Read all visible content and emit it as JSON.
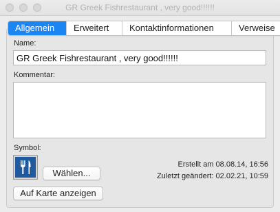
{
  "window": {
    "title": "GR Greek Fishrestaurant , very good!!!!!!"
  },
  "tabs": [
    {
      "label": "Allgemein",
      "active": true
    },
    {
      "label": "Erweitert",
      "active": false
    },
    {
      "label": "Kontaktinformationen",
      "active": false
    },
    {
      "label": "Verweise",
      "active": false
    }
  ],
  "fields": {
    "name_label": "Name:",
    "name_value": "GR Greek Fishrestaurant , very good!!!!!!",
    "comment_label": "Kommentar:",
    "comment_value": "",
    "symbol_label": "Symbol:"
  },
  "symbol": {
    "icon": "fork-knife-icon",
    "color": "#1f5a9e"
  },
  "buttons": {
    "choose": "Wählen...",
    "show_on_map": "Auf Karte anzeigen"
  },
  "meta": {
    "created": "Erstellt am 08.08.14, 16:56",
    "modified": "Zuletzt geändert: 02.02.21, 10:59"
  },
  "colors": {
    "accent": "#1b85f4"
  }
}
